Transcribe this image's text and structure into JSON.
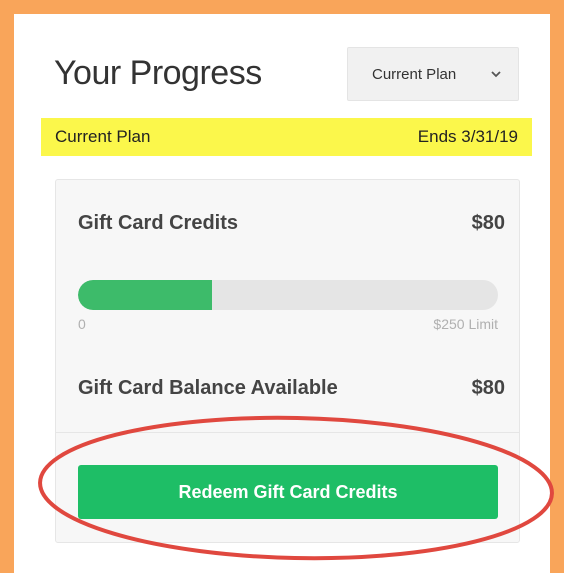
{
  "header": {
    "title": "Your Progress",
    "plan_select": {
      "selected": "Current Plan",
      "icon": "chevron-down-icon"
    }
  },
  "plan_banner": {
    "label": "Current Plan",
    "ends": "Ends 3/31/19",
    "color": "#FBF74B"
  },
  "credits": {
    "label": "Gift Card Credits",
    "amount": "$80",
    "progress_fraction": 0.32,
    "scale_min": "0",
    "scale_max": "$250 Limit",
    "fill_color": "#3DBB6A"
  },
  "balance": {
    "label": "Gift Card Balance Available",
    "amount": "$80"
  },
  "redeem": {
    "label": "Redeem Gift Card Credits",
    "color": "#1EBE66"
  },
  "colors": {
    "frame": "#F9A55A",
    "annotation": "#E0483F"
  }
}
